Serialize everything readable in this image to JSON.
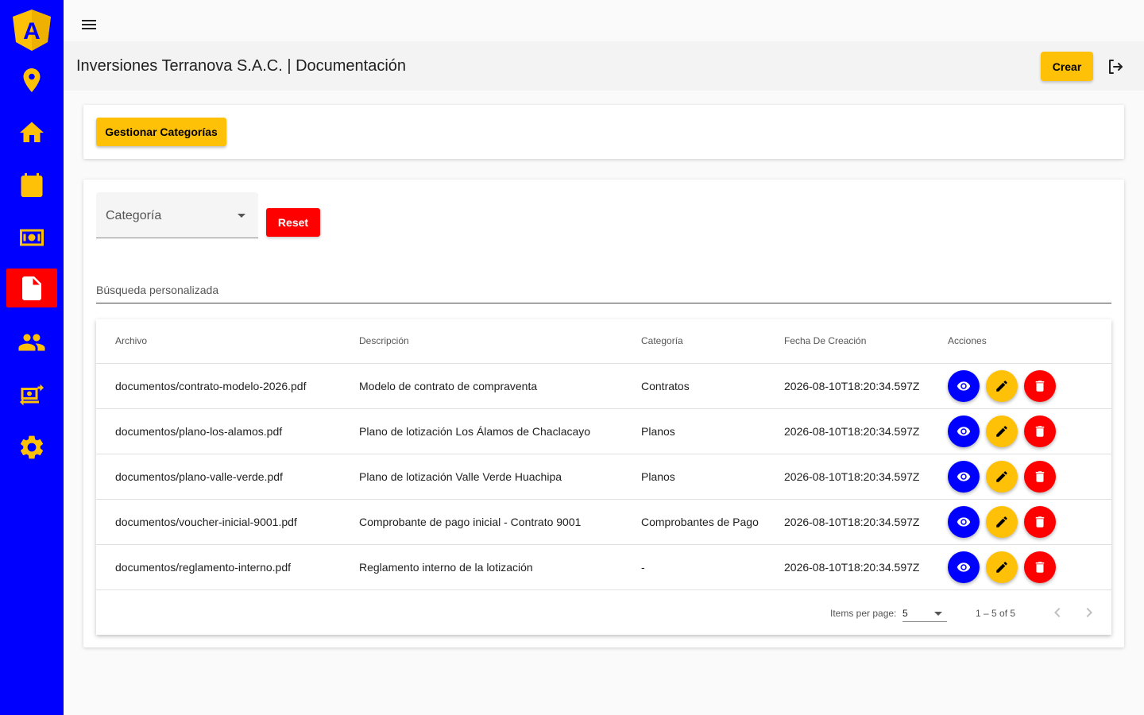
{
  "app": {
    "logo_letter": "A",
    "brand_colors": {
      "sidebar": "#0000ff",
      "accent": "#ffc107",
      "active": "#ff0000"
    }
  },
  "sidebar": {
    "items": [
      {
        "icon": "location-pin-icon",
        "active": false
      },
      {
        "icon": "home-icon",
        "active": false
      },
      {
        "icon": "calendar-icon",
        "active": false
      },
      {
        "icon": "money-icon",
        "active": false
      },
      {
        "icon": "document-icon",
        "active": true
      },
      {
        "icon": "users-icon",
        "active": false
      },
      {
        "icon": "currency-exchange-icon",
        "active": false
      },
      {
        "icon": "gear-icon",
        "active": false
      }
    ]
  },
  "header": {
    "title": "Inversiones Terranova S.A.C. | Documentación",
    "create_label": "Crear"
  },
  "toolbar": {
    "manage_categories_label": "Gestionar Categorías"
  },
  "filters": {
    "category_label": "Categoría",
    "reset_label": "Reset",
    "search_placeholder": "Búsqueda personalizada"
  },
  "table": {
    "columns": [
      "Archivo",
      "Descripción",
      "Categoría",
      "Fecha De Creación",
      "Acciones"
    ],
    "rows": [
      {
        "archivo": "documentos/contrato-modelo-2026.pdf",
        "descripcion": "Modelo de contrato de compraventa",
        "categoria": "Contratos",
        "fecha": "2026-08-10T18:20:34.597Z"
      },
      {
        "archivo": "documentos/plano-los-alamos.pdf",
        "descripcion": "Plano de lotización Los Álamos de Chaclacayo",
        "categoria": "Planos",
        "fecha": "2026-08-10T18:20:34.597Z"
      },
      {
        "archivo": "documentos/plano-valle-verde.pdf",
        "descripcion": "Plano de lotización Valle Verde Huachipa",
        "categoria": "Planos",
        "fecha": "2026-08-10T18:20:34.597Z"
      },
      {
        "archivo": "documentos/voucher-inicial-9001.pdf",
        "descripcion": "Comprobante de pago inicial - Contrato 9001",
        "categoria": "Comprobantes de Pago",
        "fecha": "2026-08-10T18:20:34.597Z"
      },
      {
        "archivo": "documentos/reglamento-interno.pdf",
        "descripcion": "Reglamento interno de la lotización",
        "categoria": "-",
        "fecha": "2026-08-10T18:20:34.597Z"
      }
    ]
  },
  "paginator": {
    "items_per_page_label": "Items per page:",
    "items_per_page_value": "5",
    "range_label": "1 – 5 of 5"
  }
}
